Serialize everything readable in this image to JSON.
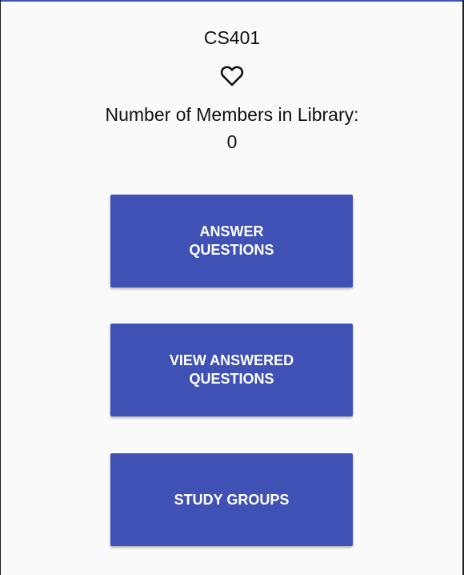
{
  "header": {
    "course_code": "CS401",
    "favorite_icon": "heart-outline-icon"
  },
  "library": {
    "members_label": "Number of Members in Library:",
    "members_count": "0"
  },
  "actions": {
    "answer_questions": "ANSWER QUESTIONS",
    "view_answered_questions": "VIEW ANSWERED QUESTIONS",
    "study_groups": "STUDY GROUPS"
  },
  "theme": {
    "primary": "#3f51b5",
    "background": "#fafafa",
    "button_text": "#ffffff"
  }
}
